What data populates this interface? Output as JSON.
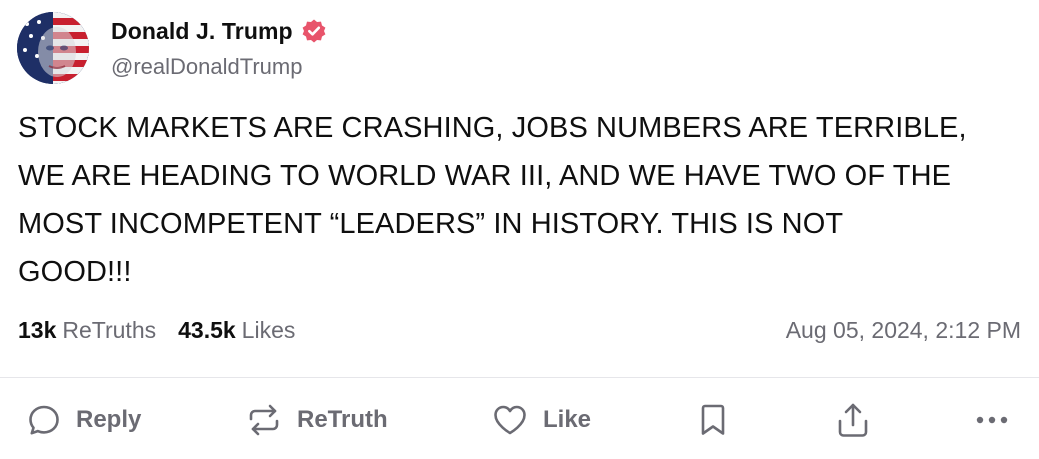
{
  "author": {
    "display_name": "Donald J. Trump",
    "handle": "@realDonaldTrump",
    "verified_color": "#e8546b"
  },
  "post": {
    "text": "STOCK MARKETS ARE CRASHING, JOBS NUMBERS ARE TERRIBLE,\nWE ARE HEADING TO WORLD WAR III, AND WE HAVE TWO OF THE\nMOST INCOMPETENT “LEADERS” IN HISTORY. THIS IS NOT\nGOOD!!!",
    "timestamp": "Aug 05, 2024, 2:12 PM"
  },
  "stats": {
    "retruths_count": "13k",
    "retruths_label": "ReTruths",
    "likes_count": "43.5k",
    "likes_label": "Likes"
  },
  "actions": {
    "reply_label": "Reply",
    "retruth_label": "ReTruth",
    "like_label": "Like",
    "icons": [
      "reply-icon",
      "retruth-icon",
      "like-icon",
      "bookmark-icon",
      "share-icon",
      "more-icon"
    ]
  },
  "colors": {
    "text": "#0f0f0f",
    "muted": "#6b6b73",
    "divider": "#e6e6ea"
  }
}
